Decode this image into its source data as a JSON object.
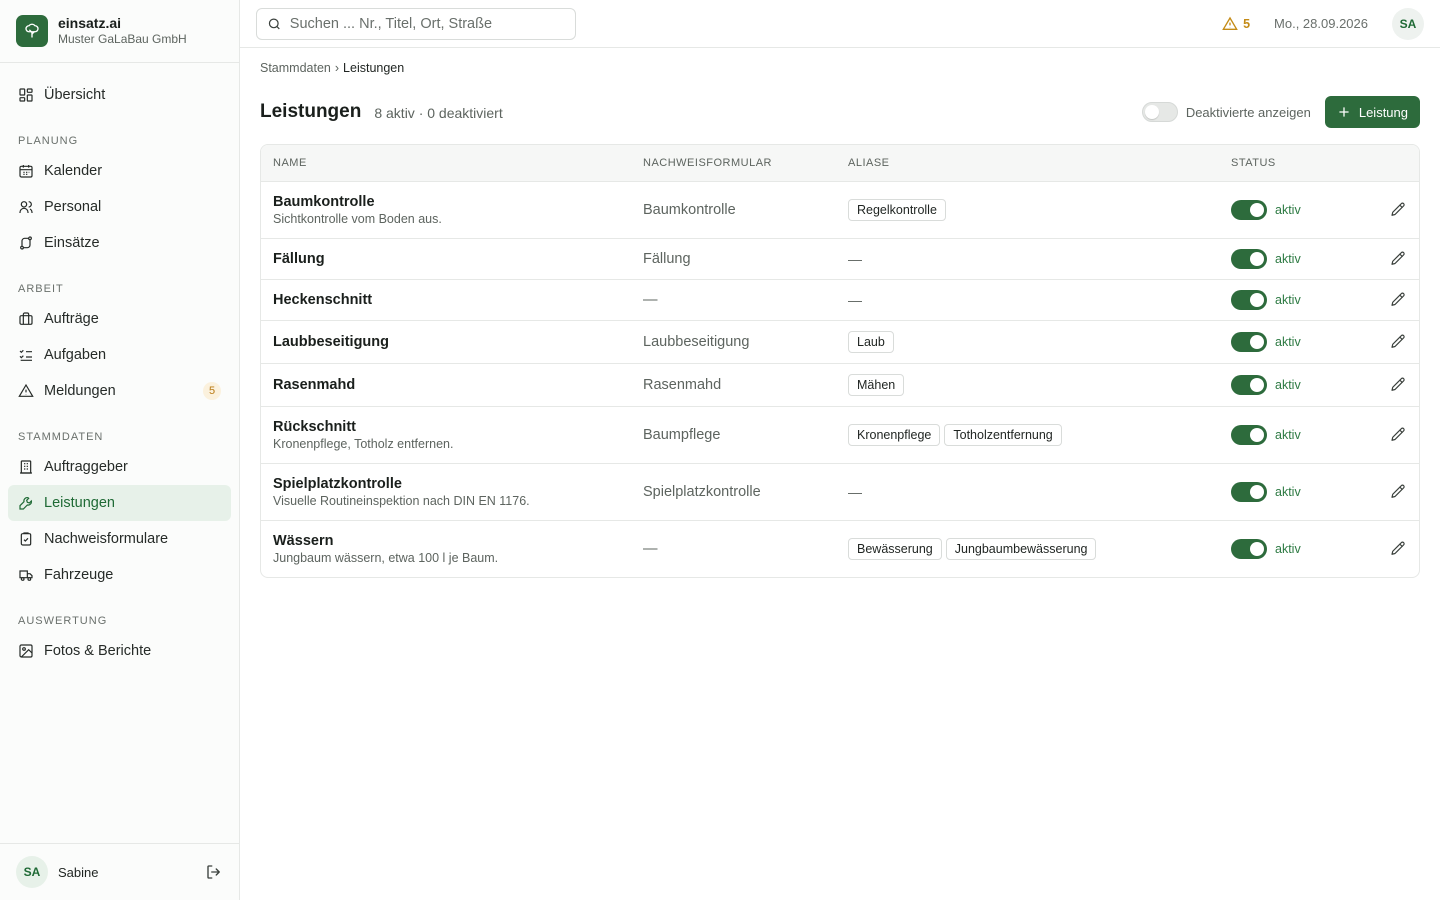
{
  "brand": {
    "name": "einsatz.ai",
    "company": "Muster GaLaBau GmbH"
  },
  "sidebar": {
    "overview": "Übersicht",
    "sections": {
      "planung": "PLANUNG",
      "arbeit": "ARBEIT",
      "stammdaten": "STAMMDATEN",
      "auswertung": "AUSWERTUNG"
    },
    "items": {
      "kalender": "Kalender",
      "personal": "Personal",
      "einsaetze": "Einsätze",
      "auftraege": "Aufträge",
      "aufgaben": "Aufgaben",
      "meldungen": "Meldungen",
      "meldungen_badge": "5",
      "auftraggeber": "Auftraggeber",
      "leistungen": "Leistungen",
      "nachweisformulare": "Nachweisformulare",
      "fahrzeuge": "Fahrzeuge",
      "fotos": "Fotos & Berichte"
    },
    "user": {
      "initials": "SA",
      "name": "Sabine"
    }
  },
  "topbar": {
    "search_placeholder": "Suchen ... Nr., Titel, Ort, Straße",
    "alerts": "5",
    "date": "Mo., 28.09.2026",
    "avatar": "SA"
  },
  "breadcrumb": {
    "parent": "Stammdaten",
    "separator": "›",
    "current": "Leistungen"
  },
  "page": {
    "title": "Leistungen",
    "subtitle": "8 aktiv · 0 deaktiviert",
    "toggle_label": "Deaktivierte anzeigen",
    "add_button": "Leistung"
  },
  "table": {
    "headers": {
      "name": "NAME",
      "form": "NACHWEISFORMULAR",
      "aliases": "ALIASE",
      "status": "STATUS"
    },
    "rows": [
      {
        "name": "Baumkontrolle",
        "desc": "Sichtkontrolle vom Boden aus.",
        "form": "Baumkontrolle",
        "aliases": [
          "Regelkontrolle"
        ],
        "status": "aktiv"
      },
      {
        "name": "Fällung",
        "desc": "",
        "form": "Fällung",
        "aliases": [],
        "status": "aktiv"
      },
      {
        "name": "Heckenschnitt",
        "desc": "",
        "form": "—",
        "aliases": [],
        "status": "aktiv"
      },
      {
        "name": "Laubbeseitigung",
        "desc": "",
        "form": "Laubbeseitigung",
        "aliases": [
          "Laub"
        ],
        "status": "aktiv"
      },
      {
        "name": "Rasenmahd",
        "desc": "",
        "form": "Rasenmahd",
        "aliases": [
          "Mähen"
        ],
        "status": "aktiv"
      },
      {
        "name": "Rückschnitt",
        "desc": "Kronenpflege, Totholz entfernen.",
        "form": "Baumpflege",
        "aliases": [
          "Kronenpflege",
          "Totholzentfernung"
        ],
        "status": "aktiv"
      },
      {
        "name": "Spielplatzkontrolle",
        "desc": "Visuelle Routineinspektion nach DIN EN 1176.",
        "form": "Spielplatzkontrolle",
        "aliases": [],
        "status": "aktiv"
      },
      {
        "name": "Wässern",
        "desc": "Jungbaum wässern, etwa 100 l je Baum.",
        "form": "—",
        "aliases": [
          "Bewässerung",
          "Jungbaumbewässerung"
        ],
        "status": "aktiv"
      }
    ],
    "empty_marker": "—"
  },
  "colors": {
    "accent": "#2d6b3c",
    "warning": "#c48b16",
    "active_bg": "#e7f1e9"
  }
}
